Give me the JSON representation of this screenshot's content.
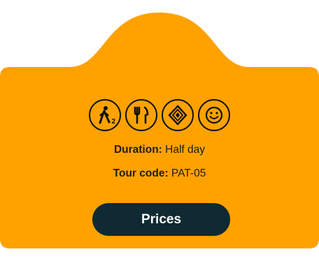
{
  "card": {
    "accent_color": "#FFA200",
    "icons": [
      {
        "name": "walking-icon",
        "subscript": "2"
      },
      {
        "name": "fork-knife-icon"
      },
      {
        "name": "diamond-pattern-icon"
      },
      {
        "name": "smiley-face-icon"
      }
    ],
    "duration": {
      "label": "Duration:",
      "value": "Half day"
    },
    "tour_code": {
      "label": "Tour code:",
      "value": "PAT-05"
    },
    "button_label": "Prices"
  }
}
